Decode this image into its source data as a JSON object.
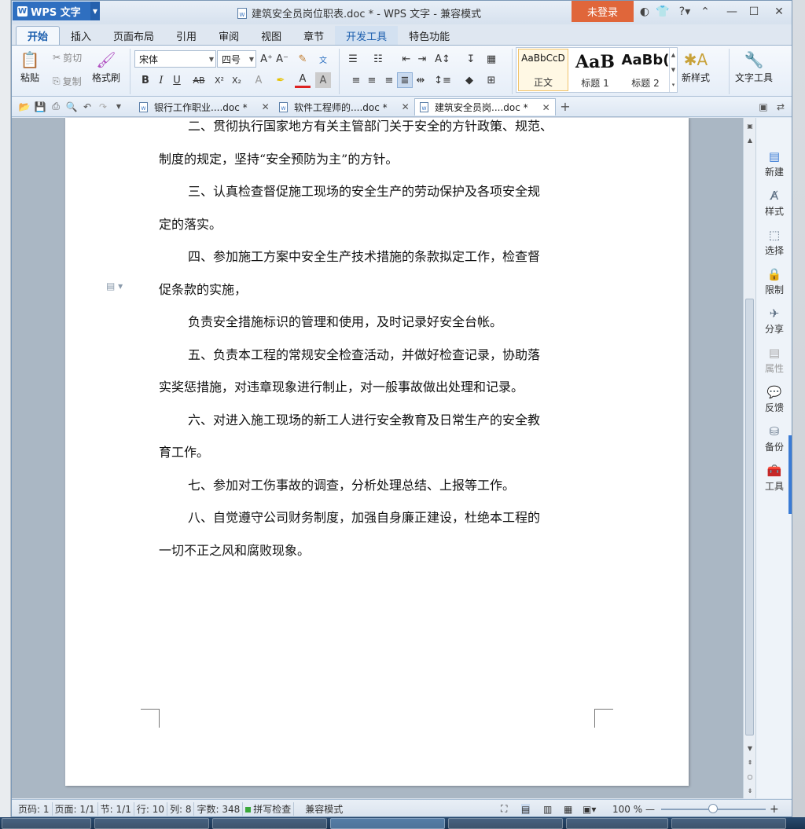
{
  "titlebar": {
    "app_button": "WPS 文字",
    "doc_title": "建筑安全员岗位职表.doc * - WPS 文字 - 兼容模式",
    "login": "未登录"
  },
  "tabs": [
    "开始",
    "插入",
    "页面布局",
    "引用",
    "审阅",
    "视图",
    "章节",
    "开发工具",
    "特色功能"
  ],
  "ribbon": {
    "paste": "粘贴",
    "cut": "剪切",
    "copy": "复制",
    "format_painter": "格式刷",
    "font_name": "宋体",
    "font_size": "四号",
    "styles": [
      {
        "sample": "AaBbCcD",
        "name": "正文"
      },
      {
        "sample": "AaB",
        "name": "标题 1"
      },
      {
        "sample": "AaBb(",
        "name": "标题 2"
      }
    ],
    "new_style": "新样式",
    "text_tools": "文字工具"
  },
  "doc_tabs": [
    {
      "label": "银行工作职业....doc *"
    },
    {
      "label": "软件工程师的....doc *"
    },
    {
      "label": "建筑安全员岗....doc *"
    }
  ],
  "document": {
    "lines": [
      "二、贯彻执行国家地方有关主管部门关于安全的方针政策、规范、",
      "制度的规定，坚持“安全预防为主”的方针。",
      "三、认真检查督促施工现场的安全生产的劳动保护及各项安全规",
      "定的落实。",
      "四、参加施工方案中安全生产技术措施的条款拟定工作，检查督",
      "促条款的实施，",
      "负责安全措施标识的管理和使用，及时记录好安全台帐。",
      "五、负责本工程的常规安全检查活动，并做好检查记录，协助落",
      "实奖惩措施，对违章现象进行制止，对一般事故做出处理和记录。",
      "六、对进入施工现场的新工人进行安全教育及日常生产的安全教",
      "育工作。",
      "七、参加对工伤事故的调查，分析处理总结、上报等工作。",
      "八、自觉遵守公司财务制度，加强自身廉正建设，杜绝本工程的",
      "一切不正之风和腐败现象。"
    ]
  },
  "sidepanel": [
    "新建",
    "样式",
    "选择",
    "限制",
    "分享",
    "属性",
    "反馈",
    "备份",
    "工具"
  ],
  "status": {
    "page_num": "页码: 1",
    "pages": "页面: 1/1",
    "section": "节: 1/1",
    "row": "行: 10",
    "col": "列: 8",
    "words": "字数: 348",
    "spellcheck": "拼写检查",
    "compat": "兼容模式",
    "zoom": "100 %"
  },
  "colors": {
    "accent": "#2f6fc0",
    "login": "#e0663a"
  }
}
